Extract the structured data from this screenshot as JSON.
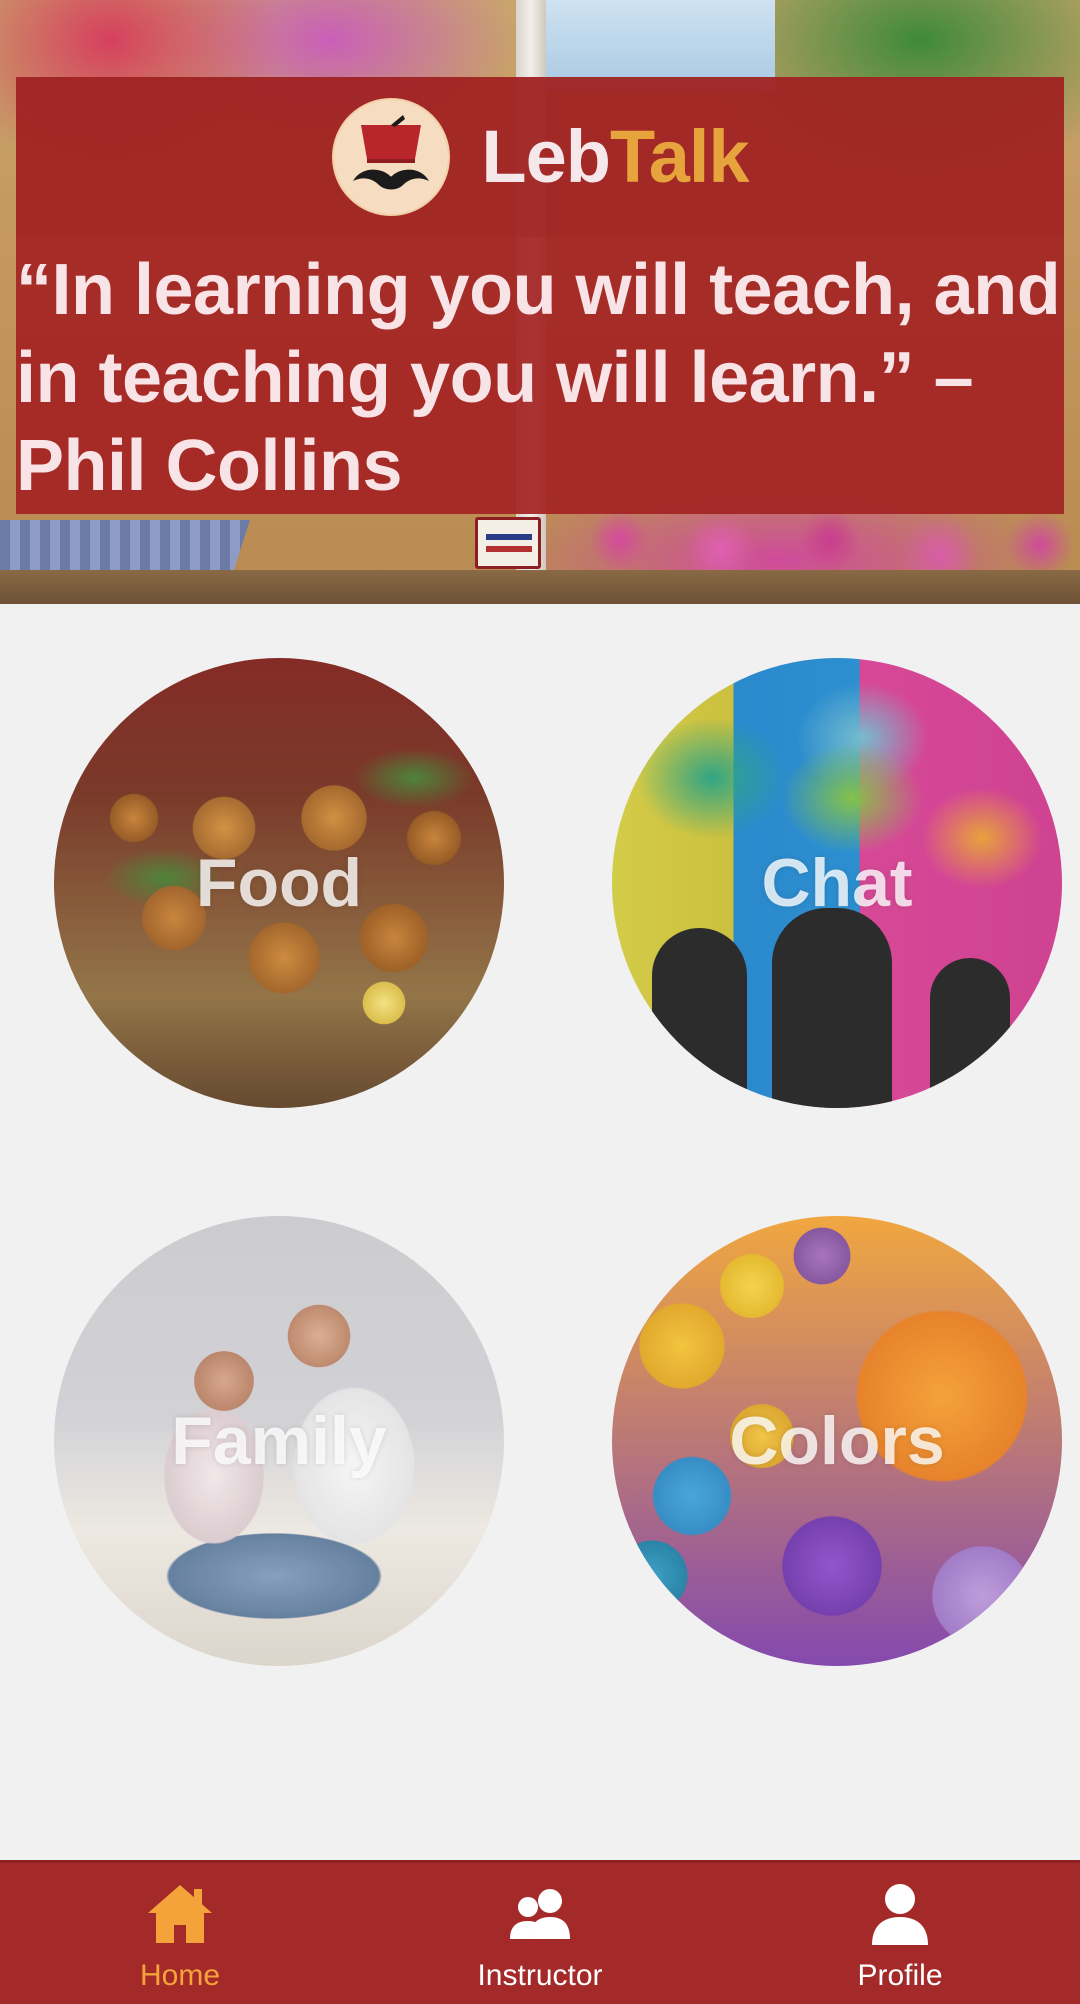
{
  "app": {
    "brand_first": "Leb",
    "brand_second": "Talk",
    "logo_icon": "mustache-fez-icon"
  },
  "hero": {
    "quote": "“In learning you will teach, and in teaching you will learn.” – Phil Collins"
  },
  "categories": [
    {
      "label": "Food"
    },
    {
      "label": "Chat"
    },
    {
      "label": "Family"
    },
    {
      "label": "Colors"
    }
  ],
  "bottom_nav": {
    "items": [
      {
        "label": "Home",
        "icon": "home-icon",
        "active": true
      },
      {
        "label": "Instructor",
        "icon": "people-icon",
        "active": false
      },
      {
        "label": "Profile",
        "icon": "person-icon",
        "active": false
      }
    ]
  },
  "colors": {
    "primary_red": "#a42a2a",
    "accent_orange": "#f4a23a",
    "brand_talk_orange": "#e7a33c",
    "background": "#f1f1f1"
  }
}
